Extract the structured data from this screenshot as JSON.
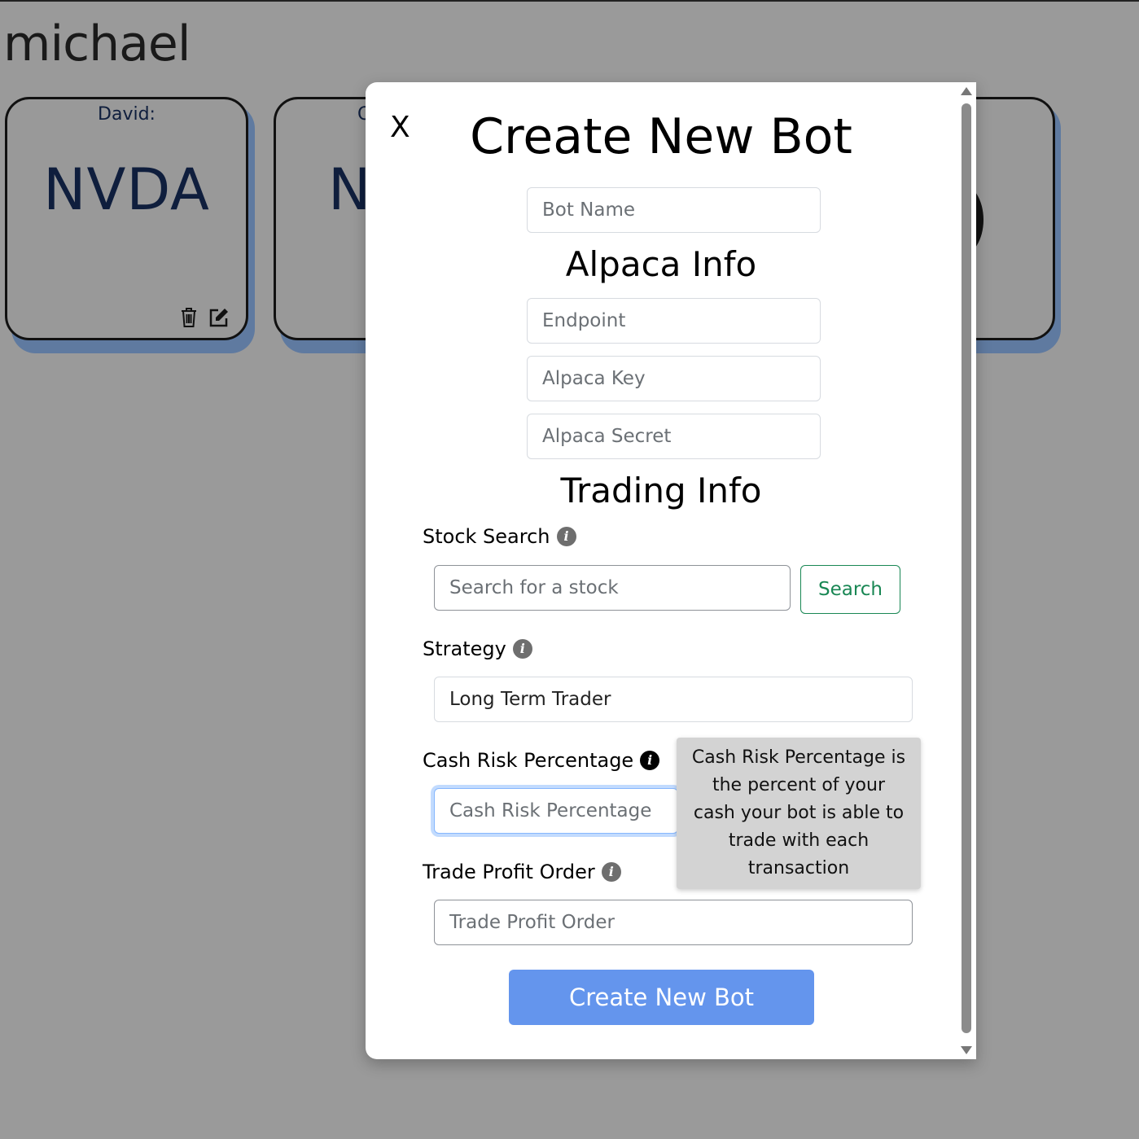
{
  "page": {
    "username": "michael"
  },
  "cards": [
    {
      "owner": "David:",
      "ticker": "NVDA"
    },
    {
      "owner": "C",
      "ticker": "N"
    }
  ],
  "modal": {
    "close_label": "X",
    "title": "Create New Bot",
    "bot_name_placeholder": "Bot Name",
    "alpaca_section": "Alpaca Info",
    "endpoint_placeholder": "Endpoint",
    "alpaca_key_placeholder": "Alpaca Key",
    "alpaca_secret_placeholder": "Alpaca Secret",
    "trading_section": "Trading Info",
    "stock_search_label": "Stock Search",
    "stock_search_placeholder": "Search for a stock",
    "search_button": "Search",
    "strategy_label": "Strategy",
    "strategy_value": "Long Term Trader",
    "cash_risk_label": "Cash Risk Percentage",
    "cash_risk_placeholder": "Cash Risk Percentage",
    "trade_profit_label": "Trade Profit Order",
    "trade_profit_placeholder": "Trade Profit Order",
    "create_button": "Create New Bot",
    "tooltip_text": "Cash Risk Percentage is the percent of your cash your bot is able to trade with each transaction",
    "info_icon": "i"
  }
}
